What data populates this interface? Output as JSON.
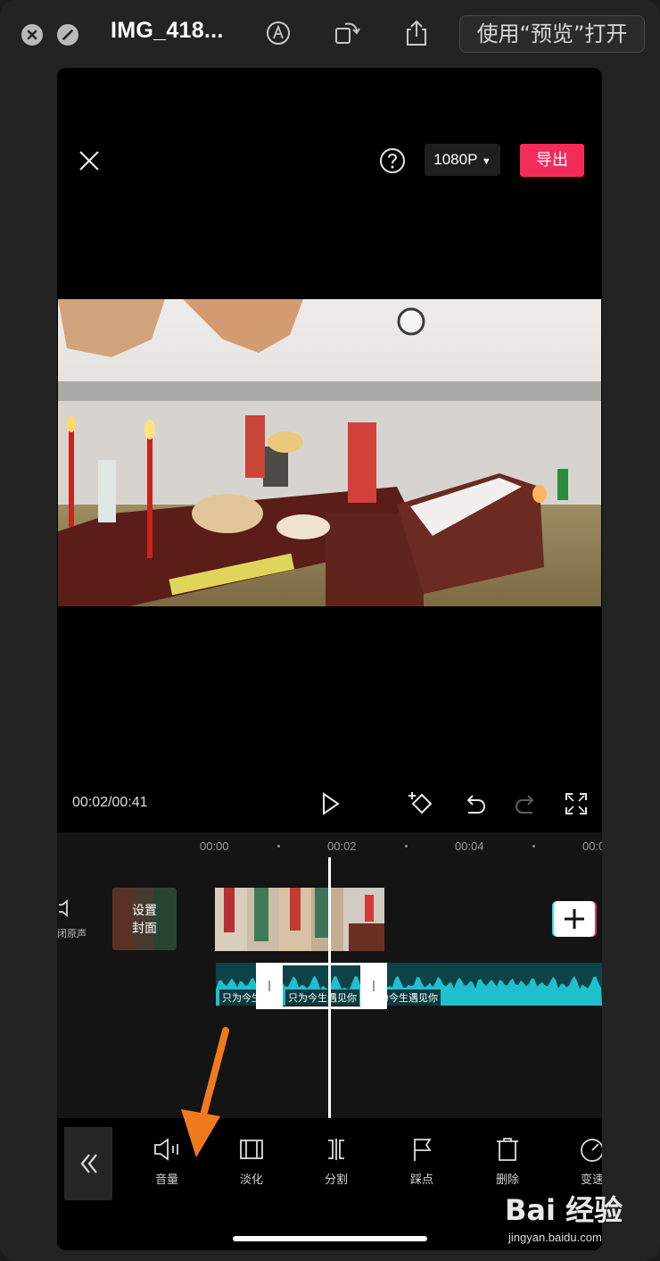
{
  "mac": {
    "title": "IMG_418...",
    "open_with": "使用“预览”打开"
  },
  "editor": {
    "resolution": "1080P",
    "export_label": "导出",
    "time_readout": "00:02/00:41"
  },
  "timeline": {
    "ruler_labels": [
      "00:00",
      "00:02",
      "00:04",
      "00:0"
    ],
    "mute_label": "闭原声",
    "cover_label_line1": "设置",
    "cover_label_line2": "封面",
    "audio_labels": [
      "只为今生",
      "只为今生遇见你",
      "为今生遇见你"
    ]
  },
  "toolbar": {
    "tools": [
      {
        "label": "音量",
        "icon": "volume-icon"
      },
      {
        "label": "淡化",
        "icon": "fade-icon"
      },
      {
        "label": "分割",
        "icon": "split-icon"
      },
      {
        "label": "踩点",
        "icon": "beat-flag-icon"
      },
      {
        "label": "删除",
        "icon": "delete-icon"
      },
      {
        "label": "变速",
        "icon": "speed-icon"
      }
    ]
  },
  "watermark": {
    "text": "Bai 经验",
    "sub": "jingyan.baidu.com"
  },
  "colors": {
    "export": "#f32c59",
    "audio_wave": "#1fbfcc",
    "annotation_arrow": "#f07a1e"
  }
}
